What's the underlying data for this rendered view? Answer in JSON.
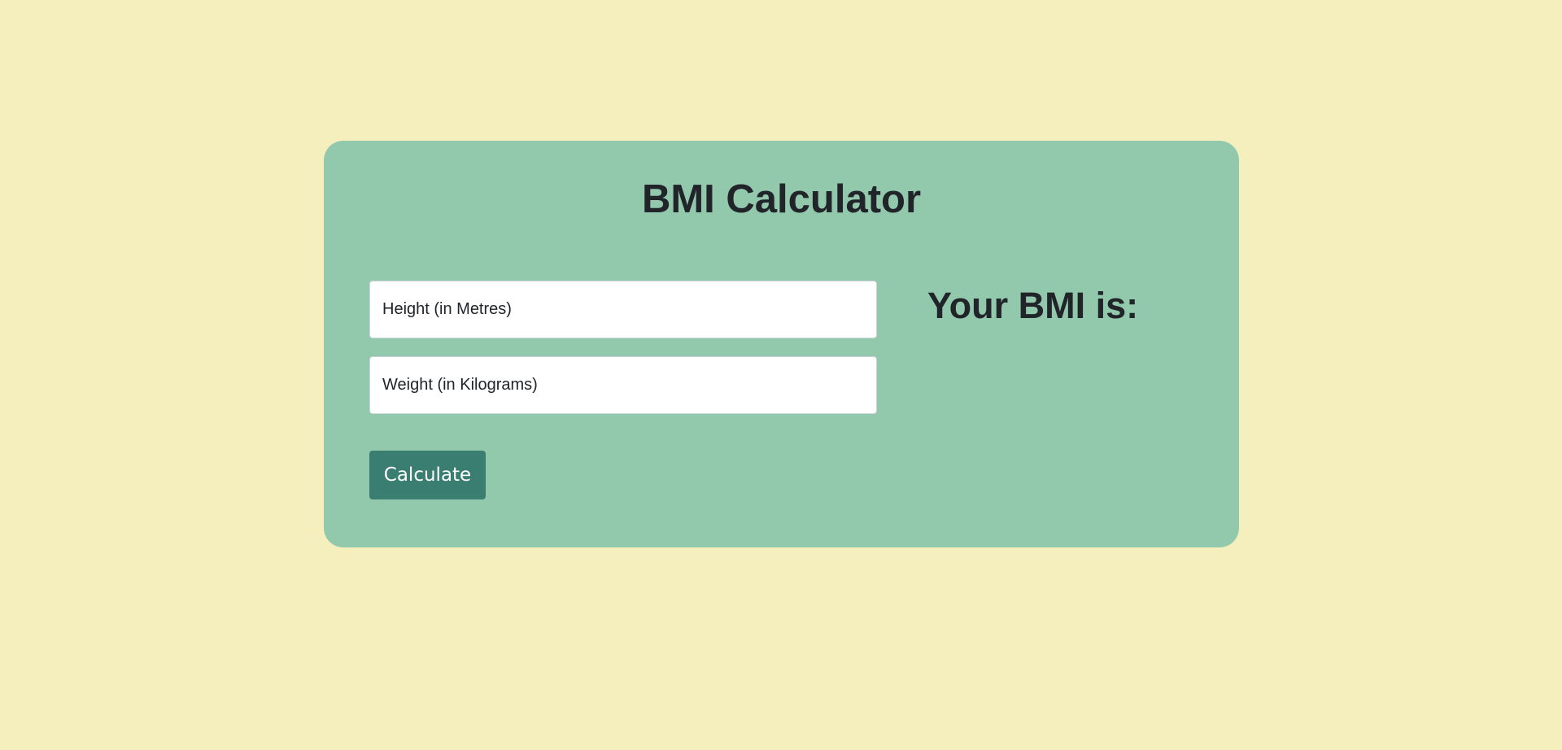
{
  "page": {
    "background_color": "#f4efbc"
  },
  "card": {
    "background_color": "#92c9ad",
    "title": "BMI Calculator"
  },
  "form": {
    "height_placeholder": "Height (in Metres)",
    "height_value": "",
    "weight_placeholder": "Weight (in Kilograms)",
    "weight_value": "",
    "calculate_label": "Calculate",
    "button_color": "#3a7d71"
  },
  "result": {
    "label": "Your BMI is:"
  }
}
